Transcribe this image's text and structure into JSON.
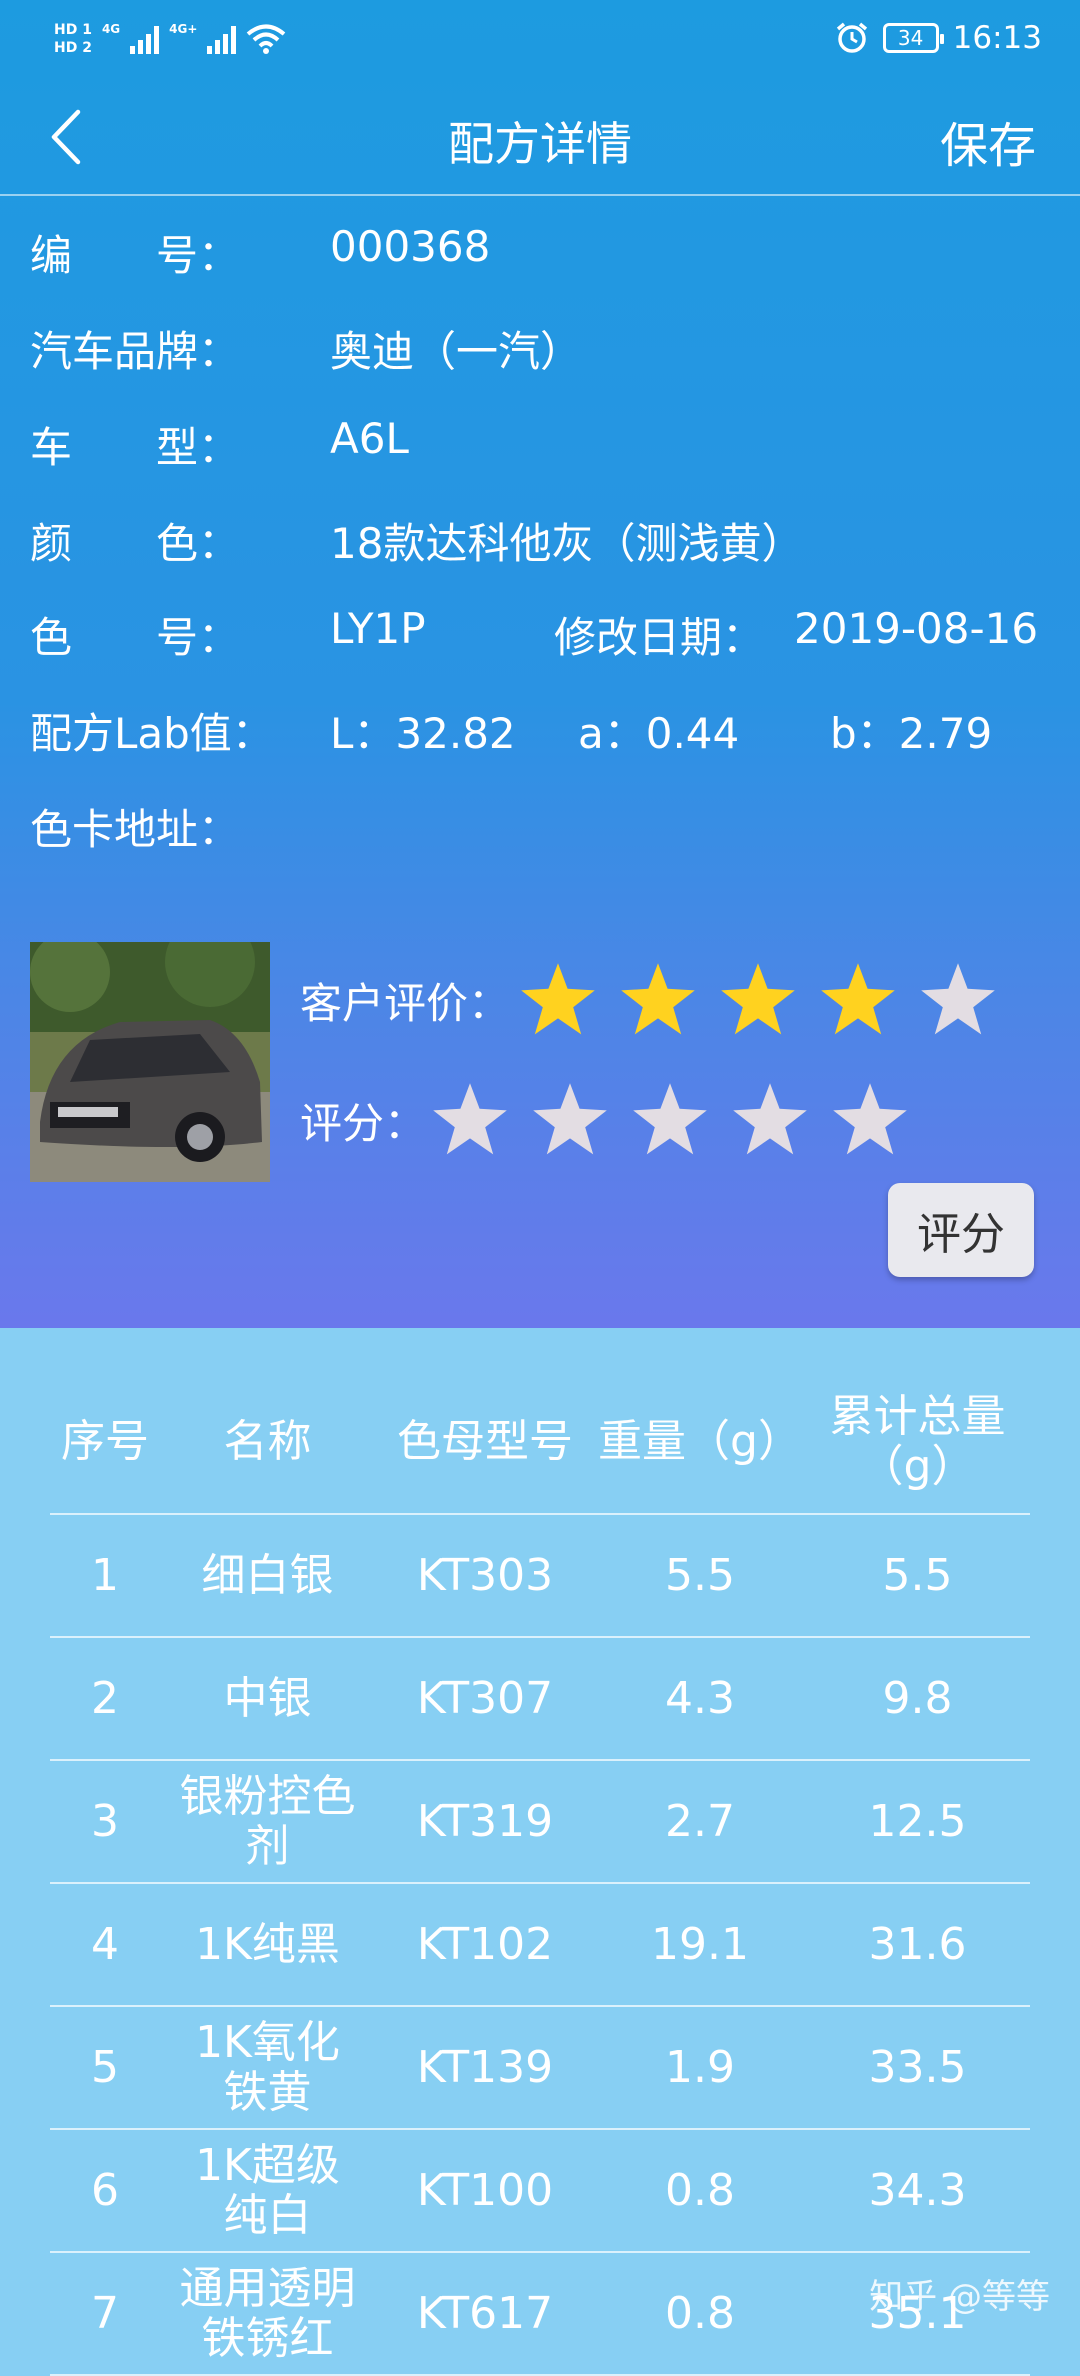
{
  "status_bar": {
    "hd1": "HD 1",
    "hd2": "HD 2",
    "net1": "4G",
    "net2": "4G+",
    "battery": "34",
    "time": "16:13"
  },
  "header": {
    "title": "配方详情",
    "save_label": "保存"
  },
  "info": {
    "code_label": "编　　号：",
    "code_value": "000368",
    "brand_label": "汽车品牌：",
    "brand_value": "奥迪（一汽）",
    "model_label": "车　　型：",
    "model_value": "A6L",
    "color_label": "颜　　色：",
    "color_value": "18款达科他灰（测浅黄）",
    "color_no_label": "色　　号：",
    "color_no_value": "LY1P",
    "mod_date_label": "修改日期：",
    "mod_date_value": "2019-08-16",
    "lab_label": "配方Lab值：",
    "lab_l": "L：32.82",
    "lab_a": "a：0.44",
    "lab_b": "b：2.79",
    "card_label": "色卡地址："
  },
  "rating": {
    "customer_label": "客户评价：",
    "customer_stars": 4,
    "score_label": "评分：",
    "score_stars": 0,
    "max_stars": 5,
    "rate_button": "评分",
    "star_on_color": "#ffd21f",
    "star_off_color": "#e3dde3"
  },
  "table": {
    "headers": [
      "序号",
      "名称",
      "色母型号",
      "重量（g）",
      "累计总量（g）"
    ],
    "rows": [
      [
        "1",
        "细白银",
        "KT303",
        "5.5",
        "5.5"
      ],
      [
        "2",
        "中银",
        "KT307",
        "4.3",
        "9.8"
      ],
      [
        "3",
        "银粉控色剂",
        "KT319",
        "2.7",
        "12.5"
      ],
      [
        "4",
        "1K纯黑",
        "KT102",
        "19.1",
        "31.6"
      ],
      [
        "5",
        "1K氧化铁黄",
        "KT139",
        "1.9",
        "33.5"
      ],
      [
        "6",
        "1K超级纯白",
        "KT100",
        "0.8",
        "34.3"
      ],
      [
        "7",
        "通用透明铁锈红",
        "KT617",
        "0.8",
        "35.1"
      ]
    ]
  },
  "watermark": "知乎 @等等"
}
